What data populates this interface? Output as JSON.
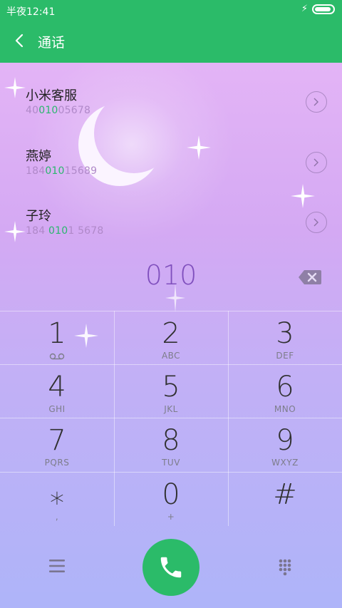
{
  "status_bar": {
    "time": "半夜12:41"
  },
  "header": {
    "title": "通话"
  },
  "contacts": [
    {
      "name": "小米客服",
      "number_parts": [
        "40",
        "010",
        "05678"
      ]
    },
    {
      "name": "燕婷",
      "number_parts": [
        "184",
        "010",
        "15689"
      ]
    },
    {
      "name": "子玲",
      "number_parts": [
        "184 ",
        "010",
        "1 5678"
      ]
    }
  ],
  "dialed_number": "010",
  "keypad": [
    {
      "digit": "1",
      "letters": ""
    },
    {
      "digit": "2",
      "letters": "ABC"
    },
    {
      "digit": "3",
      "letters": "DEF"
    },
    {
      "digit": "4",
      "letters": "GHI"
    },
    {
      "digit": "5",
      "letters": "JKL"
    },
    {
      "digit": "6",
      "letters": "MNO"
    },
    {
      "digit": "7",
      "letters": "PQRS"
    },
    {
      "digit": "8",
      "letters": "TUV"
    },
    {
      "digit": "9",
      "letters": "WXYZ"
    },
    {
      "digit": "⁎",
      "letters": ","
    },
    {
      "digit": "0",
      "letters": "+"
    },
    {
      "digit": "#",
      "letters": ""
    }
  ],
  "icons": {
    "back": "back-arrow-icon",
    "detail": "chevron-right-icon",
    "delete": "backspace-icon",
    "voicemail": "voicemail-icon",
    "menu": "hamburger-menu-icon",
    "call": "phone-icon",
    "dialpad": "dialpad-icon"
  },
  "colors": {
    "accent": "#2bbb69",
    "dialed": "#7f4fbd",
    "match_highlight": "#2bb66e"
  }
}
